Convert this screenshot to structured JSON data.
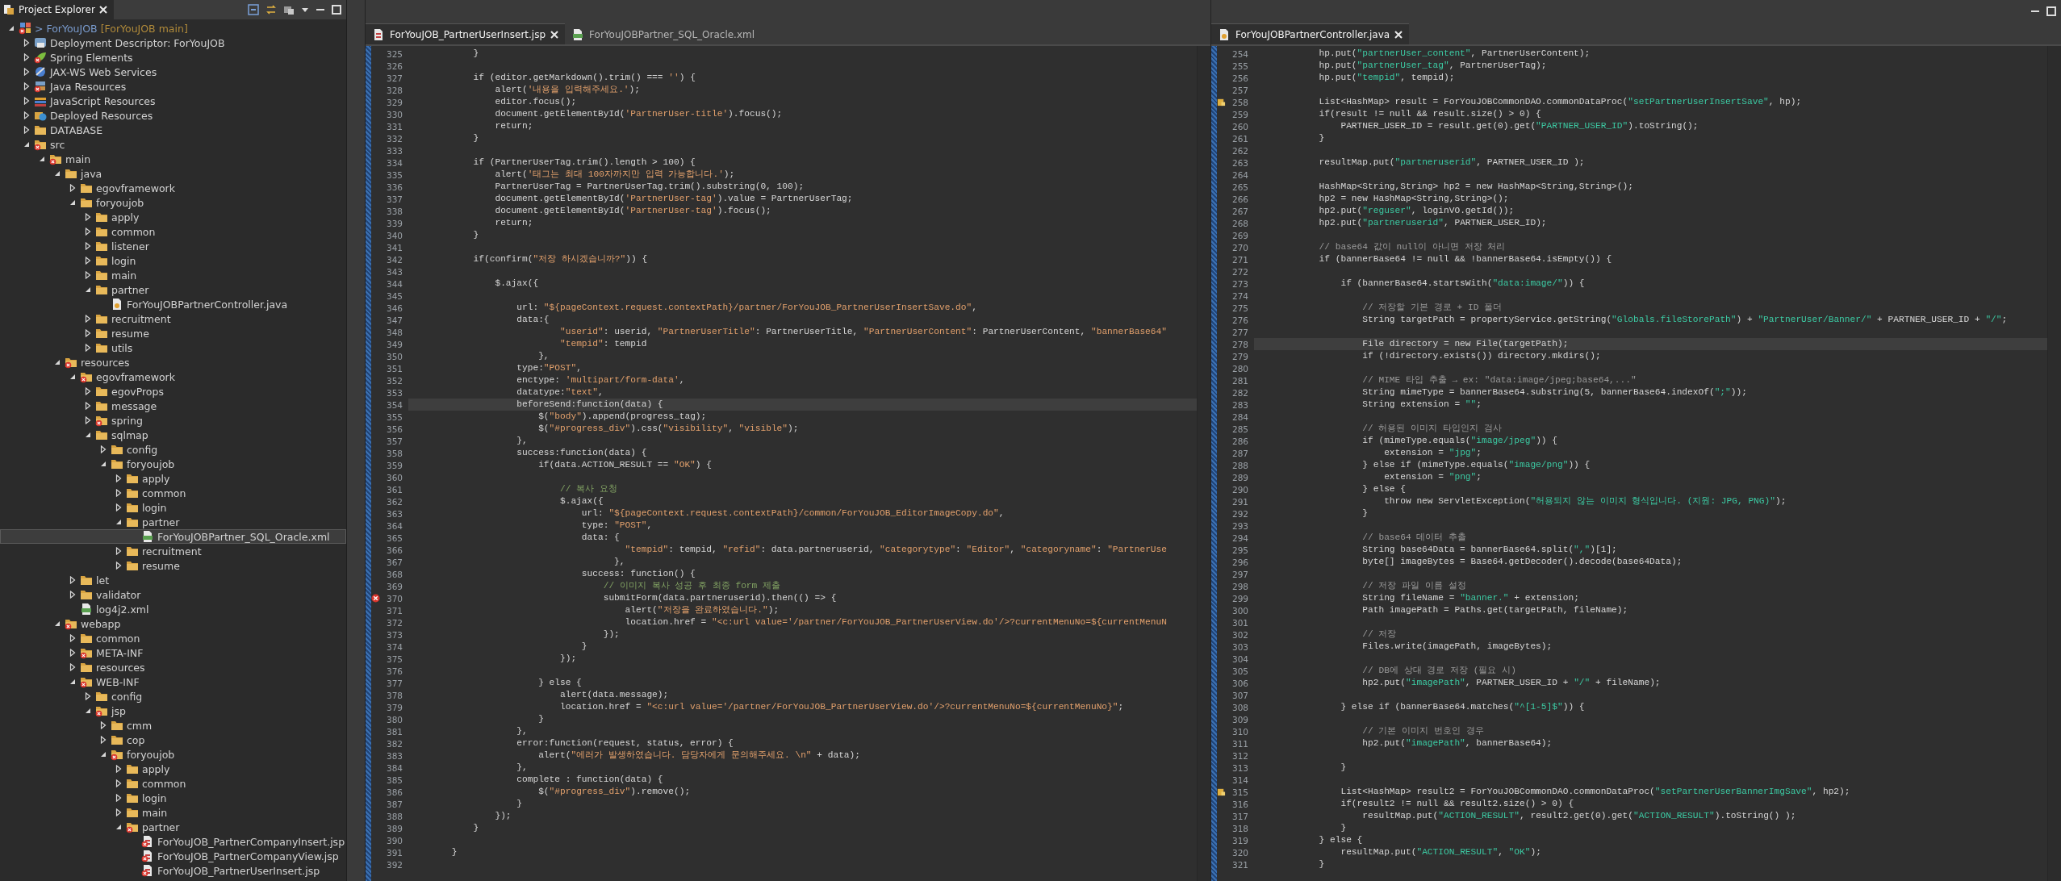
{
  "explorer": {
    "title": "Project Explorer",
    "tree": [
      {
        "kind": "project",
        "label": "> ForYouJOB",
        "branch": "[ForYouJOB main]",
        "error": true,
        "selected": false,
        "expanded": true,
        "children": [
          {
            "kind": "descriptor",
            "label": "Deployment Descriptor: ForYouJOB",
            "error": false,
            "selected": false,
            "expanded": false
          },
          {
            "kind": "spring",
            "label": "Spring Elements",
            "error": true,
            "selected": false,
            "expanded": false
          },
          {
            "kind": "webservices",
            "label": "JAX-WS Web Services",
            "error": false,
            "selected": false,
            "expanded": false
          },
          {
            "kind": "library",
            "label": "Java Resources",
            "error": true,
            "selected": false,
            "expanded": false
          },
          {
            "kind": "jslibrary",
            "label": "JavaScript Resources",
            "error": false,
            "selected": false,
            "expanded": false
          },
          {
            "kind": "deployed",
            "label": "Deployed Resources",
            "error": false,
            "selected": false,
            "expanded": false
          },
          {
            "kind": "folder",
            "label": "DATABASE",
            "error": false,
            "selected": false,
            "expanded": false
          },
          {
            "kind": "folder",
            "label": "src",
            "error": true,
            "selected": false,
            "expanded": true,
            "children": [
              {
                "kind": "folder",
                "label": "main",
                "error": true,
                "selected": false,
                "expanded": true,
                "children": [
                  {
                    "kind": "folder",
                    "label": "java",
                    "error": false,
                    "selected": false,
                    "expanded": true,
                    "children": [
                      {
                        "kind": "folder",
                        "label": "egovframework",
                        "error": false,
                        "selected": false,
                        "expanded": false
                      },
                      {
                        "kind": "folder",
                        "label": "foryoujob",
                        "error": false,
                        "selected": false,
                        "expanded": true,
                        "children": [
                          {
                            "kind": "folder",
                            "label": "apply",
                            "error": false,
                            "selected": false,
                            "expanded": false
                          },
                          {
                            "kind": "folder",
                            "label": "common",
                            "error": false,
                            "selected": false,
                            "expanded": false
                          },
                          {
                            "kind": "folder",
                            "label": "listener",
                            "error": false,
                            "selected": false,
                            "expanded": false
                          },
                          {
                            "kind": "folder",
                            "label": "login",
                            "error": false,
                            "selected": false,
                            "expanded": false
                          },
                          {
                            "kind": "folder",
                            "label": "main",
                            "error": false,
                            "selected": false,
                            "expanded": false
                          },
                          {
                            "kind": "folder",
                            "label": "partner",
                            "error": false,
                            "selected": false,
                            "expanded": true,
                            "children": [
                              {
                                "kind": "java",
                                "label": "ForYouJOBPartnerController.java",
                                "error": false,
                                "selected": false
                              }
                            ]
                          },
                          {
                            "kind": "folder",
                            "label": "recruitment",
                            "error": false,
                            "selected": false,
                            "expanded": false
                          },
                          {
                            "kind": "folder",
                            "label": "resume",
                            "error": false,
                            "selected": false,
                            "expanded": false
                          },
                          {
                            "kind": "folder",
                            "label": "utils",
                            "error": false,
                            "selected": false,
                            "expanded": false
                          }
                        ]
                      }
                    ]
                  },
                  {
                    "kind": "folder",
                    "label": "resources",
                    "error": true,
                    "selected": false,
                    "expanded": true,
                    "children": [
                      {
                        "kind": "folder",
                        "label": "egovframework",
                        "error": true,
                        "selected": false,
                        "expanded": true,
                        "children": [
                          {
                            "kind": "folder",
                            "label": "egovProps",
                            "error": false,
                            "selected": false,
                            "expanded": false
                          },
                          {
                            "kind": "folder",
                            "label": "message",
                            "error": false,
                            "selected": false,
                            "expanded": false
                          },
                          {
                            "kind": "folder",
                            "label": "spring",
                            "error": true,
                            "selected": false,
                            "expanded": false
                          },
                          {
                            "kind": "folder",
                            "label": "sqlmap",
                            "error": false,
                            "selected": false,
                            "expanded": true,
                            "children": [
                              {
                                "kind": "folder",
                                "label": "config",
                                "error": false,
                                "selected": false,
                                "expanded": false
                              },
                              {
                                "kind": "folder",
                                "label": "foryoujob",
                                "error": false,
                                "selected": false,
                                "expanded": true,
                                "children": [
                                  {
                                    "kind": "folder",
                                    "label": "apply",
                                    "error": false,
                                    "selected": false,
                                    "expanded": false
                                  },
                                  {
                                    "kind": "folder",
                                    "label": "common",
                                    "error": false,
                                    "selected": false,
                                    "expanded": false
                                  },
                                  {
                                    "kind": "folder",
                                    "label": "login",
                                    "error": false,
                                    "selected": false,
                                    "expanded": false
                                  },
                                  {
                                    "kind": "folder",
                                    "label": "partner",
                                    "error": false,
                                    "selected": false,
                                    "expanded": true,
                                    "children": [
                                      {
                                        "kind": "xml",
                                        "label": "ForYouJOBPartner_SQL_Oracle.xml",
                                        "error": false,
                                        "selected": true
                                      }
                                    ]
                                  },
                                  {
                                    "kind": "folder",
                                    "label": "recruitment",
                                    "error": false,
                                    "selected": false,
                                    "expanded": false
                                  },
                                  {
                                    "kind": "folder",
                                    "label": "resume",
                                    "error": false,
                                    "selected": false,
                                    "expanded": false
                                  }
                                ]
                              }
                            ]
                          }
                        ]
                      },
                      {
                        "kind": "folder",
                        "label": "let",
                        "error": false,
                        "selected": false,
                        "expanded": false
                      },
                      {
                        "kind": "folder",
                        "label": "validator",
                        "error": false,
                        "selected": false,
                        "expanded": false
                      },
                      {
                        "kind": "xml",
                        "label": "log4j2.xml",
                        "error": false,
                        "selected": false
                      }
                    ]
                  },
                  {
                    "kind": "folder",
                    "label": "webapp",
                    "error": true,
                    "selected": false,
                    "expanded": true,
                    "children": [
                      {
                        "kind": "folder",
                        "label": "common",
                        "error": false,
                        "selected": false,
                        "expanded": false
                      },
                      {
                        "kind": "folder",
                        "label": "META-INF",
                        "error": true,
                        "selected": false,
                        "expanded": false
                      },
                      {
                        "kind": "folder",
                        "label": "resources",
                        "error": false,
                        "selected": false,
                        "expanded": false
                      },
                      {
                        "kind": "folder",
                        "label": "WEB-INF",
                        "error": true,
                        "selected": false,
                        "expanded": true,
                        "children": [
                          {
                            "kind": "folder",
                            "label": "config",
                            "error": false,
                            "selected": false,
                            "expanded": false
                          },
                          {
                            "kind": "folder",
                            "label": "jsp",
                            "error": true,
                            "selected": false,
                            "expanded": true,
                            "children": [
                              {
                                "kind": "folder",
                                "label": "cmm",
                                "error": false,
                                "selected": false,
                                "expanded": false
                              },
                              {
                                "kind": "folder",
                                "label": "cop",
                                "error": false,
                                "selected": false,
                                "expanded": false
                              },
                              {
                                "kind": "folder",
                                "label": "foryoujob",
                                "error": true,
                                "selected": false,
                                "expanded": true,
                                "children": [
                                  {
                                    "kind": "folder",
                                    "label": "apply",
                                    "error": false,
                                    "selected": false,
                                    "expanded": false
                                  },
                                  {
                                    "kind": "folder",
                                    "label": "common",
                                    "error": false,
                                    "selected": false,
                                    "expanded": false
                                  },
                                  {
                                    "kind": "folder",
                                    "label": "login",
                                    "error": false,
                                    "selected": false,
                                    "expanded": false
                                  },
                                  {
                                    "kind": "folder",
                                    "label": "main",
                                    "error": false,
                                    "selected": false,
                                    "expanded": false
                                  },
                                  {
                                    "kind": "folder",
                                    "label": "partner",
                                    "error": true,
                                    "selected": false,
                                    "expanded": true,
                                    "children": [
                                      {
                                        "kind": "jsp",
                                        "label": "ForYouJOB_PartnerCompanyInsert.jsp",
                                        "error": true,
                                        "selected": false
                                      },
                                      {
                                        "kind": "jsp",
                                        "label": "ForYouJOB_PartnerCompanyView.jsp",
                                        "error": true,
                                        "selected": false
                                      },
                                      {
                                        "kind": "jsp",
                                        "label": "ForYouJOB_PartnerUserInsert.jsp",
                                        "error": true,
                                        "selected": false
                                      }
                                    ]
                                  }
                                ]
                              }
                            ]
                          }
                        ]
                      }
                    ]
                  }
                ]
              }
            ]
          }
        ]
      }
    ]
  },
  "editors": [
    {
      "kind": "jsp",
      "tabs": [
        {
          "kind": "jsp",
          "label": "ForYouJOB_PartnerUserInsert.jsp",
          "selected": true
        },
        {
          "kind": "xml",
          "label": "ForYouJOBPartner_SQL_Oracle.xml",
          "selected": false
        }
      ],
      "lines": [
        {
          "n": "325",
          "text": "            }",
          "current": false
        },
        {
          "n": "326",
          "current": false
        },
        {
          "n": "327",
          "text": "            if (editor.getMarkdown().trim() === '') {",
          "current": false
        },
        {
          "n": "328",
          "text": "                alert('내용을 입력해주세요.');",
          "current": false
        },
        {
          "n": "329",
          "text": "                editor.focus();",
          "current": false
        },
        {
          "n": "330",
          "text": "                document.getElementById('PartnerUser-title').focus();",
          "current": false
        },
        {
          "n": "331",
          "text": "                return;",
          "current": false
        },
        {
          "n": "332",
          "text": "            }",
          "current": false
        },
        {
          "n": "333",
          "current": false
        },
        {
          "n": "334",
          "text": "            if (PartnerUserTag.trim().length > 100) {",
          "current": false
        },
        {
          "n": "335",
          "text": "                alert('태그는 최대 100자까지만 입력 가능합니다.');",
          "current": false
        },
        {
          "n": "336",
          "text": "                PartnerUserTag = PartnerUserTag.trim().substring(0, 100);",
          "current": false
        },
        {
          "n": "337",
          "text": "                document.getElementById('PartnerUser-tag').value = PartnerUserTag;",
          "current": false
        },
        {
          "n": "338",
          "text": "                document.getElementById('PartnerUser-tag').focus();",
          "current": false
        },
        {
          "n": "339",
          "text": "                return;",
          "current": false
        },
        {
          "n": "340",
          "text": "            }",
          "current": false
        },
        {
          "n": "341",
          "current": false
        },
        {
          "n": "342",
          "text": "            if(confirm(\"저장 하시겠습니까?\")) {",
          "current": false
        },
        {
          "n": "343",
          "current": false
        },
        {
          "n": "344",
          "text": "                $.ajax({",
          "current": false
        },
        {
          "n": "345",
          "current": false
        },
        {
          "n": "346",
          "text": "                    url: \"${pageContext.request.contextPath}/partner/ForYouJOB_PartnerUserInsertSave.do\",",
          "current": false
        },
        {
          "n": "347",
          "text": "                    data:{",
          "current": false
        },
        {
          "n": "348",
          "text": "                            \"userid\": userid, \"PartnerUserTitle\": PartnerUserTitle, \"PartnerUserContent\": PartnerUserContent, \"bannerBase64\"",
          "current": false
        },
        {
          "n": "349",
          "text": "                            \"tempid\": tempid",
          "current": false
        },
        {
          "n": "350",
          "text": "                        },",
          "current": false
        },
        {
          "n": "351",
          "text": "                    type:\"POST\",",
          "current": false
        },
        {
          "n": "352",
          "text": "                    enctype: 'multipart/form-data',",
          "current": false
        },
        {
          "n": "353",
          "text": "                    datatype:\"text\",",
          "current": false
        },
        {
          "n": "354",
          "text": "                    beforeSend:function(data) {",
          "current": true
        },
        {
          "n": "355",
          "text": "                        $(\"body\").append(progress_tag);",
          "current": false
        },
        {
          "n": "356",
          "text": "                        $(\"#progress_div\").css(\"visibility\", \"visible\");",
          "current": false
        },
        {
          "n": "357",
          "text": "                    },",
          "current": false
        },
        {
          "n": "358",
          "text": "                    success:function(data) {",
          "current": false
        },
        {
          "n": "359",
          "text": "                        if(data.ACTION_RESULT == \"OK\") {",
          "current": false
        },
        {
          "n": "360",
          "current": false
        },
        {
          "n": "361",
          "text": "                            // 복사 요청",
          "current": false
        },
        {
          "n": "362",
          "text": "                            $.ajax({",
          "current": false
        },
        {
          "n": "363",
          "text": "                                url: \"${pageContext.request.contextPath}/common/ForYouJOB_EditorImageCopy.do\",",
          "current": false
        },
        {
          "n": "364",
          "text": "                                type: \"POST\",",
          "current": false
        },
        {
          "n": "365",
          "text": "                                data: {",
          "current": false
        },
        {
          "n": "366",
          "text": "                                        \"tempid\": tempid, \"refid\": data.partneruserid, \"categorytype\": \"Editor\", \"categoryname\": \"PartnerUse",
          "current": false
        },
        {
          "n": "367",
          "text": "                                      },",
          "current": false
        },
        {
          "n": "368",
          "text": "                                success: function() {",
          "current": false
        },
        {
          "n": "369",
          "text": "                                    // 이미지 복사 성공 후 최종 form 제출",
          "current": false
        },
        {
          "n": "370",
          "text": "                                    submitForm(data.partneruserid).then(() => {",
          "current": false,
          "error": true
        },
        {
          "n": "371",
          "text": "                                        alert(\"저장을 완료하였습니다.\");",
          "current": false
        },
        {
          "n": "372",
          "text": "                                        location.href = \"<c:url value='/partner/ForYouJOB_PartnerUserView.do'/>?currentMenuNo=${currentMenuN",
          "current": false
        },
        {
          "n": "373",
          "text": "                                    });",
          "current": false
        },
        {
          "n": "374",
          "text": "                                }",
          "current": false
        },
        {
          "n": "375",
          "text": "                            });",
          "current": false
        },
        {
          "n": "376",
          "current": false
        },
        {
          "n": "377",
          "text": "                        } else {",
          "current": false
        },
        {
          "n": "378",
          "text": "                            alert(data.message);",
          "current": false
        },
        {
          "n": "379",
          "text": "                            location.href = \"<c:url value='/partner/ForYouJOB_PartnerUserView.do'/>?currentMenuNo=${currentMenuNo}\";",
          "current": false
        },
        {
          "n": "380",
          "text": "                        }",
          "current": false
        },
        {
          "n": "381",
          "text": "                    },",
          "current": false
        },
        {
          "n": "382",
          "text": "                    error:function(request, status, error) {",
          "current": false
        },
        {
          "n": "383",
          "text": "                        alert(\"에러가 발생하였습니다. 담당자에게 문의해주세요. \\n\" + data);",
          "current": false
        },
        {
          "n": "384",
          "text": "                    },",
          "current": false
        },
        {
          "n": "385",
          "text": "                    complete : function(data) {",
          "current": false
        },
        {
          "n": "386",
          "text": "                        $(\"#progress_div\").remove();",
          "current": false
        },
        {
          "n": "387",
          "text": "                    }",
          "current": false
        },
        {
          "n": "388",
          "text": "                });",
          "current": false
        },
        {
          "n": "389",
          "text": "            }",
          "current": false
        },
        {
          "n": "390",
          "current": false
        },
        {
          "n": "391",
          "text": "        }",
          "current": false
        },
        {
          "n": "392",
          "current": false
        }
      ]
    },
    {
      "kind": "java",
      "tabs": [
        {
          "kind": "java",
          "label": "ForYouJOBPartnerController.java",
          "selected": true
        }
      ],
      "lines": [
        {
          "n": "254",
          "text": "            hp.put(\"partnerUser_content\", PartnerUserContent);",
          "current": false
        },
        {
          "n": "255",
          "text": "            hp.put(\"partnerUser_tag\", PartnerUserTag);",
          "current": false
        },
        {
          "n": "256",
          "text": "            hp.put(\"tempid\", tempid);",
          "current": false
        },
        {
          "n": "257",
          "current": false
        },
        {
          "n": "258",
          "text": "            List<HashMap> result = ForYouJOBCommonDAO.commonDataProc(\"setPartnerUserInsertSave\", hp);",
          "current": false,
          "warning": true
        },
        {
          "n": "259",
          "text": "            if(result != null && result.size() > 0) {",
          "current": false
        },
        {
          "n": "260",
          "text": "                PARTNER_USER_ID = result.get(0).get(\"PARTNER_USER_ID\").toString();",
          "current": false
        },
        {
          "n": "261",
          "text": "            }",
          "current": false
        },
        {
          "n": "262",
          "current": false
        },
        {
          "n": "263",
          "text": "            resultMap.put(\"partneruserid\", PARTNER_USER_ID );",
          "current": false
        },
        {
          "n": "264",
          "current": false
        },
        {
          "n": "265",
          "text": "            HashMap<String,String> hp2 = new HashMap<String,String>();",
          "current": false
        },
        {
          "n": "266",
          "text": "            hp2 = new HashMap<String,String>();",
          "current": false
        },
        {
          "n": "267",
          "text": "            hp2.put(\"reguser\", loginVO.getId());",
          "current": false
        },
        {
          "n": "268",
          "text": "            hp2.put(\"partneruserid\", PARTNER_USER_ID);",
          "current": false
        },
        {
          "n": "269",
          "current": false
        },
        {
          "n": "270",
          "text": "            // base64 값이 null이 아니면 저장 처리",
          "current": false
        },
        {
          "n": "271",
          "text": "            if (bannerBase64 != null && !bannerBase64.isEmpty()) {",
          "current": false
        },
        {
          "n": "272",
          "current": false
        },
        {
          "n": "273",
          "text": "                if (bannerBase64.startsWith(\"data:image/\")) {",
          "current": false
        },
        {
          "n": "274",
          "current": false
        },
        {
          "n": "275",
          "text": "                    // 저장할 기본 경로 + ID 폴더",
          "current": false
        },
        {
          "n": "276",
          "text": "                    String targetPath = propertyService.getString(\"Globals.fileStorePath\") + \"PartnerUser/Banner/\" + PARTNER_USER_ID + \"/\";",
          "current": false
        },
        {
          "n": "277",
          "current": false
        },
        {
          "n": "278",
          "text": "                    File directory = new File(targetPath);",
          "current": true
        },
        {
          "n": "279",
          "text": "                    if (!directory.exists()) directory.mkdirs();",
          "current": false
        },
        {
          "n": "280",
          "current": false
        },
        {
          "n": "281",
          "text": "                    // MIME 타입 추출 → ex: \"data:image/jpeg;base64,...\"",
          "current": false
        },
        {
          "n": "282",
          "text": "                    String mimeType = bannerBase64.substring(5, bannerBase64.indexOf(\";\"));",
          "current": false
        },
        {
          "n": "283",
          "text": "                    String extension = \"\";",
          "current": false
        },
        {
          "n": "284",
          "current": false
        },
        {
          "n": "285",
          "text": "                    // 허용된 이미지 타입인지 검사",
          "current": false
        },
        {
          "n": "286",
          "text": "                    if (mimeType.equals(\"image/jpeg\")) {",
          "current": false
        },
        {
          "n": "287",
          "text": "                        extension = \"jpg\";",
          "current": false
        },
        {
          "n": "288",
          "text": "                    } else if (mimeType.equals(\"image/png\")) {",
          "current": false
        },
        {
          "n": "289",
          "text": "                        extension = \"png\";",
          "current": false
        },
        {
          "n": "290",
          "text": "                    } else {",
          "current": false
        },
        {
          "n": "291",
          "text": "                        throw new ServletException(\"허용되지 않는 이미지 형식입니다. (지원: JPG, PNG)\");",
          "current": false
        },
        {
          "n": "292",
          "text": "                    }",
          "current": false
        },
        {
          "n": "293",
          "current": false
        },
        {
          "n": "294",
          "text": "                    // base64 데이터 추출",
          "current": false
        },
        {
          "n": "295",
          "text": "                    String base64Data = bannerBase64.split(\",\")[1];",
          "current": false
        },
        {
          "n": "296",
          "text": "                    byte[] imageBytes = Base64.getDecoder().decode(base64Data);",
          "current": false
        },
        {
          "n": "297",
          "current": false
        },
        {
          "n": "298",
          "text": "                    // 저장 파일 이름 설정",
          "current": false
        },
        {
          "n": "299",
          "text": "                    String fileName = \"banner.\" + extension;",
          "current": false
        },
        {
          "n": "300",
          "text": "                    Path imagePath = Paths.get(targetPath, fileName);",
          "current": false
        },
        {
          "n": "301",
          "current": false
        },
        {
          "n": "302",
          "text": "                    // 저장",
          "current": false
        },
        {
          "n": "303",
          "text": "                    Files.write(imagePath, imageBytes);",
          "current": false
        },
        {
          "n": "304",
          "current": false
        },
        {
          "n": "305",
          "text": "                    // DB에 상대 경로 저장 (필요 시)",
          "current": false
        },
        {
          "n": "306",
          "text": "                    hp2.put(\"imagePath\", PARTNER_USER_ID + \"/\" + fileName);",
          "current": false
        },
        {
          "n": "307",
          "current": false
        },
        {
          "n": "308",
          "text": "                } else if (bannerBase64.matches(\"^[1-5]$\")) {",
          "current": false
        },
        {
          "n": "309",
          "current": false
        },
        {
          "n": "310",
          "text": "                    // 기본 이미지 번호인 경우",
          "current": false
        },
        {
          "n": "311",
          "text": "                    hp2.put(\"imagePath\", bannerBase64);",
          "current": false
        },
        {
          "n": "312",
          "current": false
        },
        {
          "n": "313",
          "text": "                }",
          "current": false
        },
        {
          "n": "314",
          "current": false
        },
        {
          "n": "315",
          "text": "                List<HashMap> result2 = ForYouJOBCommonDAO.commonDataProc(\"setPartnerUserBannerImgSave\", hp2);",
          "current": false,
          "warning": true
        },
        {
          "n": "316",
          "text": "                if(result2 != null && result2.size() > 0) {",
          "current": false
        },
        {
          "n": "317",
          "text": "                    resultMap.put(\"ACTION_RESULT\", result2.get(0).get(\"ACTION_RESULT\").toString() );",
          "current": false
        },
        {
          "n": "318",
          "text": "                }",
          "current": false
        },
        {
          "n": "319",
          "text": "            } else {",
          "current": false
        },
        {
          "n": "320",
          "text": "                resultMap.put(\"ACTION_RESULT\", \"OK\");",
          "current": false
        },
        {
          "n": "321",
          "text": "            }",
          "current": false
        }
      ]
    }
  ]
}
